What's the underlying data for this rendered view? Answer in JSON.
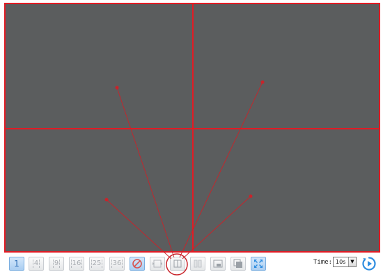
{
  "video": {
    "panes": [
      {
        "id": "pane-1"
      },
      {
        "id": "pane-2"
      },
      {
        "id": "pane-3"
      },
      {
        "id": "pane-4"
      }
    ]
  },
  "toolbar": {
    "layout_1_label": "1",
    "layout_4_label": "4",
    "layout_9_label": "9",
    "layout_16_label": "16",
    "layout_25_label": "25",
    "layout_36_label": "36",
    "time_label": "Time:",
    "time_value": "10s",
    "icons": [
      "stop-all-icon",
      "swap-channels-icon",
      "single-view-icon",
      "dual-view-icon",
      "picture-in-picture-icon",
      "overlay-view-icon",
      "fullscreen-icon",
      "play-sequence-icon"
    ]
  },
  "colors": {
    "accent": "#e21b24",
    "pane_bg": "#5b5d5e",
    "active_button": "#a9cdf1",
    "play_icon": "#2e8de0"
  }
}
